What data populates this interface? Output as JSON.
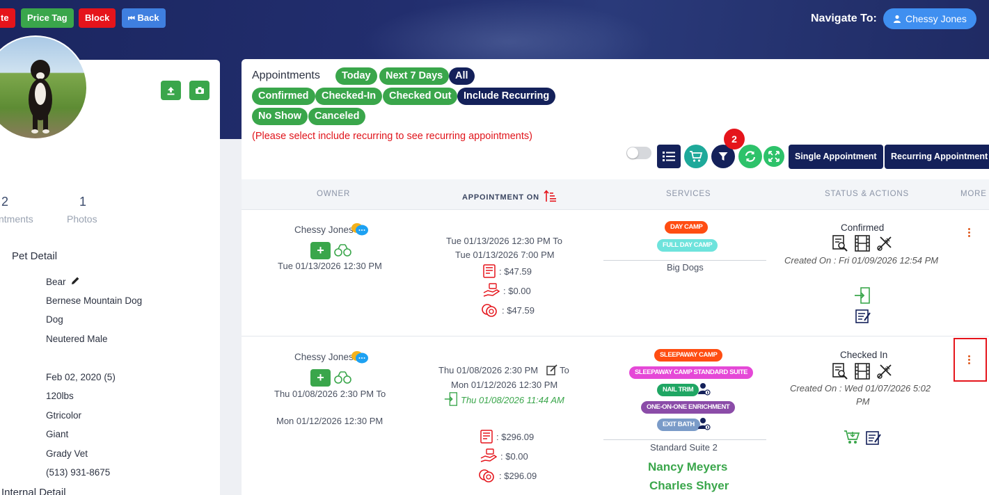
{
  "top_buttons": {
    "delete_partial": "te",
    "price_tag": "Price Tag",
    "block": "Block",
    "back": "Back"
  },
  "navigate": {
    "label": "Navigate To:",
    "user": "Chessy Jones"
  },
  "profile": {
    "stats": [
      {
        "value": "2",
        "label": "ntments"
      },
      {
        "value": "1",
        "label": "Photos"
      }
    ],
    "pet_detail_title": "Pet Detail",
    "pet_name": "Bear",
    "details": [
      "Bernese Mountain Dog",
      "Dog",
      "Neutered Male",
      "Feb 02, 2020  (5)",
      "120lbs",
      "Gtricolor",
      "Giant",
      "Grady Vet",
      "(513) 931-8675"
    ],
    "internal_detail_title": "Internal Detail"
  },
  "appointments": {
    "title": "Appointments",
    "filters_row1": [
      "Today",
      "Next 7 Days",
      "All"
    ],
    "filters_row2": [
      "Confirmed",
      "Checked-In",
      "Checked Out",
      "Include Recurring"
    ],
    "filters_row3": [
      "No Show",
      "Canceled"
    ],
    "notice": "(Please select include recurring to see recurring appointments)",
    "filter_count": "2",
    "single_button": "Single Appointment",
    "recurring_button": "Recurring Appointment",
    "columns": [
      "OWNER",
      "APPOINTMENT ON",
      "SERVICES",
      "STATUS & ACTIONS",
      "MORE"
    ],
    "rows": [
      {
        "owner": "Chessy Jones",
        "owner_date": "Tue 01/13/2026 12:30 PM",
        "appt_line1": "Tue 01/13/2026 12:30 PM To",
        "appt_line2": "Tue 01/13/2026 7:00 PM",
        "invoice": ": $47.59",
        "paid": ": $0.00",
        "balance": ": $47.59",
        "services": [
          "DAY CAMP",
          "FULL DAY CAMP"
        ],
        "service_group": "Big Dogs",
        "status": "Confirmed",
        "created": "Created On : Fri 01/09/2026 12:54 PM"
      },
      {
        "owner": "Chessy Jones",
        "owner_date1": "Thu 01/08/2026 2:30 PM To",
        "owner_date2": "Mon 01/12/2026 12:30 PM",
        "appt_line1": "Thu 01/08/2026 2:30 PM",
        "appt_to": "To",
        "appt_line2": "Mon 01/12/2026 12:30 PM",
        "checkin": "Thu 01/08/2026 11:44 AM",
        "invoice": ": $296.09",
        "paid": ": $0.00",
        "balance": ": $296.09",
        "services": [
          "SLEEPAWAY CAMP",
          "SLEEPAWAY CAMP STANDARD SUITE",
          "NAIL TRIM",
          "ONE-ON-ONE ENRICHMENT",
          "EXIT BATH"
        ],
        "service_group": "Standard Suite 2",
        "staff": [
          "Nancy Meyers",
          "Charles Shyer"
        ],
        "status": "Checked In",
        "created_line1": "Created On : Wed 01/07/2026 5:02",
        "created_line2": "PM"
      }
    ]
  },
  "colors": {
    "accent_green": "#3aa64b",
    "navy": "#14215a",
    "danger": "#e5141b",
    "brand_blue": "#3f8ff0"
  }
}
